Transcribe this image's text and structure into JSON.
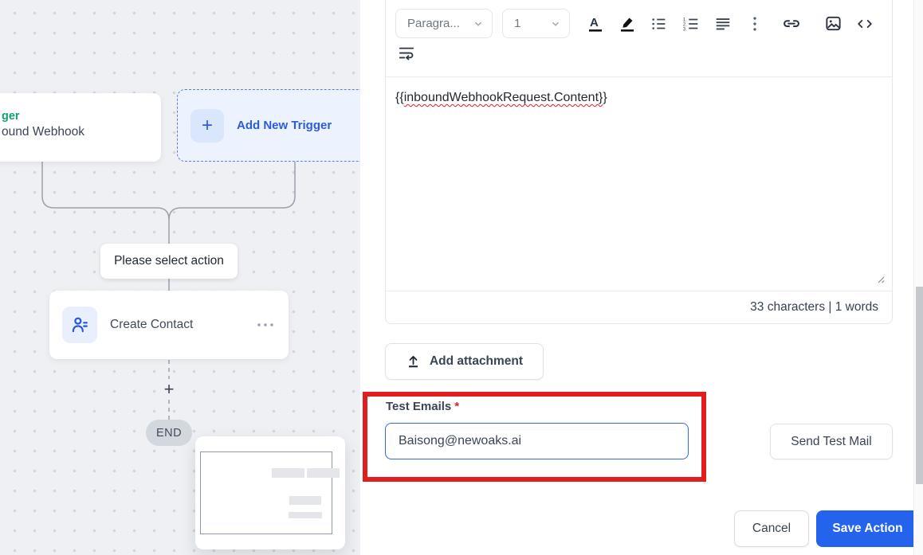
{
  "colors": {
    "accent_blue": "#2463eb",
    "annotation_red": "#e21d1d",
    "trigger_green": "#149e70",
    "link_blue": "#2b5ce0"
  },
  "canvas": {
    "trigger_card": {
      "title": "ger",
      "subtitle": "ound Webhook"
    },
    "add_trigger": {
      "plus": "+",
      "label": "Add New Trigger"
    },
    "action_prompt": "Please select action",
    "create_contact": {
      "label": "Create Contact"
    },
    "add_step_plus": "+",
    "end_badge": "END"
  },
  "editor": {
    "paragraph_select": "Paragra...",
    "size_select": "1",
    "toolbar_icons": [
      "font-color-icon",
      "highlight-icon",
      "bullet-list-icon",
      "ordered-list-icon",
      "align-icon",
      "more-options-icon",
      "insert-link-icon",
      "insert-image-icon",
      "code-view-icon",
      "text-wrap-icon"
    ],
    "body": {
      "open": "{{",
      "variable": "inboundWebhookRequest.Content}",
      "close": "}"
    },
    "stats": "33 characters | 1 words"
  },
  "attachment": {
    "label": "Add attachment",
    "icon": "upload-icon"
  },
  "test_emails": {
    "label": "Test Emails",
    "required": "*",
    "value": "Baisong@newoaks.ai"
  },
  "buttons": {
    "send_test": "Send Test Mail",
    "cancel": "Cancel",
    "save": "Save Action"
  },
  "icons": {
    "create_contact": "contact-card-icon",
    "card_menu": "ellipsis-horizontal-icon",
    "select_chevron": "chevron-down-icon"
  }
}
